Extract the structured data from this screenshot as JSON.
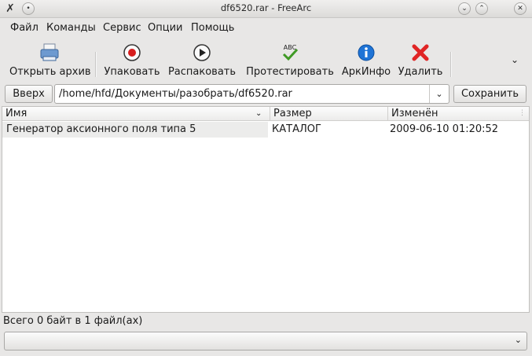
{
  "window": {
    "title": "df6520.rar - FreeArc",
    "app_icon": "freearc-app-icon",
    "buttons": [
      "help-icon",
      "minimize-icon",
      "maximize-icon",
      "close-icon"
    ]
  },
  "menu": {
    "items": [
      "Файл",
      "Команды",
      "Сервис",
      "Опции",
      "Помощь"
    ]
  },
  "toolbar": {
    "open": "Открыть архив",
    "add": "Упаковать",
    "extract": "Распаковать",
    "test": "Протестировать",
    "info": "АркИнфо",
    "delete": "Удалить",
    "test_badge": "ABC"
  },
  "nav": {
    "up_label": "Вверх",
    "path": "/home/hfd/Документы/разобрать/df6520.rar",
    "save_label": "Сохранить"
  },
  "filelist": {
    "columns": [
      "Имя",
      "Размер",
      "Изменён"
    ],
    "rows": [
      {
        "name": "Генератор аксионного поля типа 5",
        "size": "КАТАЛОГ",
        "modified": "2009-06-10 01:20:52"
      }
    ]
  },
  "status": {
    "text": "Всего 0 байт в 1 файл(ах)"
  },
  "colors": {
    "window_bg": "#e8e7e6",
    "record_red": "#d71d1d",
    "info_blue": "#1f74d6",
    "delete_red": "#e02525",
    "check_green": "#3f9a25"
  }
}
